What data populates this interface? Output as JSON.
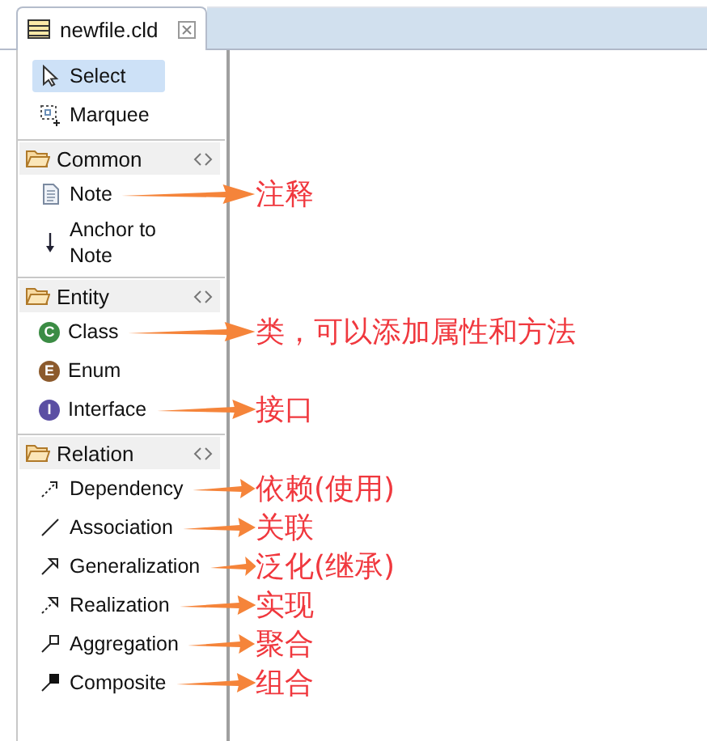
{
  "tab": {
    "title": "newfile.cld",
    "selected": true
  },
  "palette": [
    {
      "kind": "tools",
      "items": [
        {
          "label": "Select",
          "kind": "pointer",
          "selected": true
        },
        {
          "label": "Marquee",
          "kind": "marquee",
          "selected": false
        }
      ]
    },
    {
      "kind": "drawer",
      "title": "Common",
      "expanded": true,
      "items": [
        {
          "label": "Note",
          "kind": "note",
          "selected": false,
          "annotation": "注释"
        },
        {
          "label": "Anchor to Note",
          "kind": "anchor",
          "selected": false
        }
      ]
    },
    {
      "kind": "drawer",
      "title": "Entity",
      "expanded": true,
      "items": [
        {
          "label": "Class",
          "kind": "class",
          "badge": "C",
          "selected": false,
          "annotation": "类，可以添加属性和方法"
        },
        {
          "label": "Enum",
          "kind": "enum",
          "badge": "E",
          "selected": false
        },
        {
          "label": "Interface",
          "kind": "interface",
          "badge": "I",
          "selected": false,
          "annotation": "接口"
        }
      ]
    },
    {
      "kind": "drawer",
      "title": "Relation",
      "expanded": true,
      "items": [
        {
          "label": "Dependency",
          "kind": "dependency",
          "selected": false,
          "annotation": "依赖(使用)"
        },
        {
          "label": "Association",
          "kind": "association",
          "selected": false,
          "annotation": "关联"
        },
        {
          "label": "Generalization",
          "kind": "generalization",
          "selected": false,
          "annotation": "泛化(继承)"
        },
        {
          "label": "Realization",
          "kind": "realization",
          "selected": false,
          "annotation": "实现"
        },
        {
          "label": "Aggregation",
          "kind": "aggregation",
          "selected": false,
          "annotation": "聚合"
        },
        {
          "label": "Composite",
          "kind": "composite",
          "selected": false,
          "annotation": "组合"
        }
      ]
    }
  ]
}
